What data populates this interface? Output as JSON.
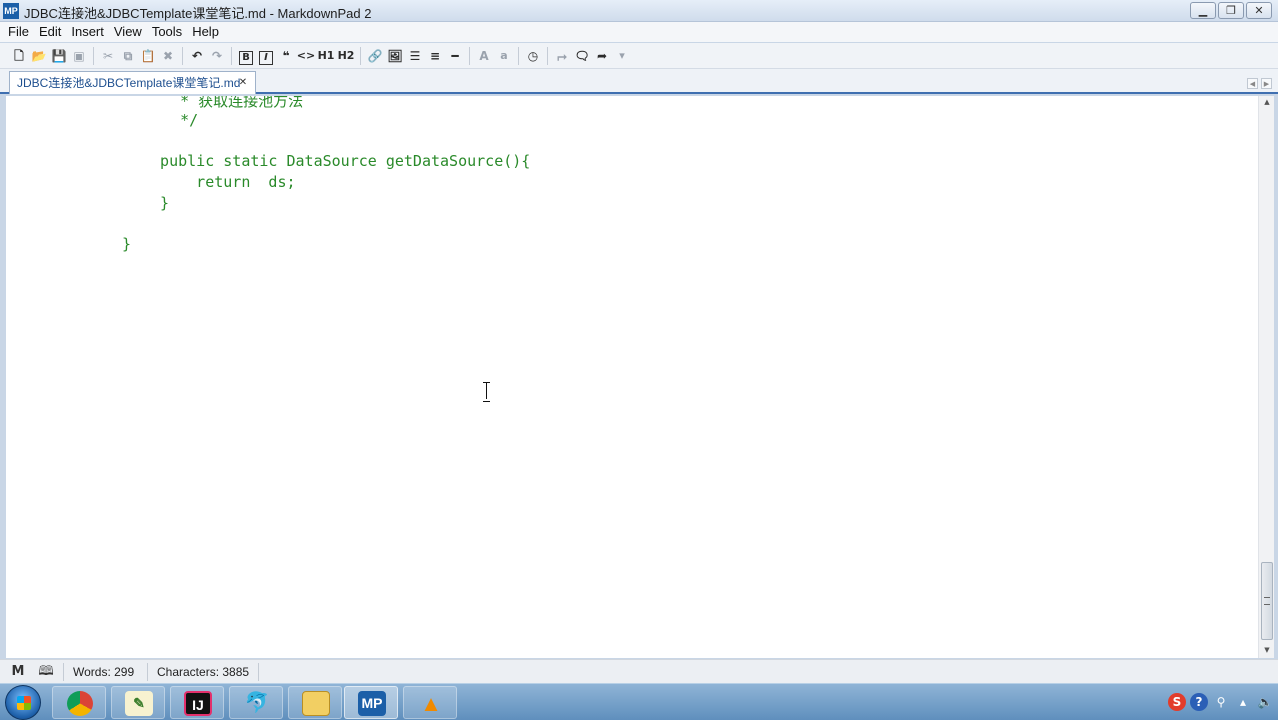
{
  "window": {
    "app_icon_text": "MP",
    "title": "JDBC连接池&JDBCTemplate课堂笔记.md - MarkdownPad 2",
    "minimize": "▁",
    "maximize": "❐",
    "close": "✕"
  },
  "menu": [
    "File",
    "Edit",
    "Insert",
    "View",
    "Tools",
    "Help"
  ],
  "toolbar": {
    "bold": "B",
    "italic": "I",
    "quote": "❝",
    "code": "<>",
    "h1": "H1",
    "h2": "H2",
    "font_large": "A",
    "font_small": "a"
  },
  "tab": {
    "label": "JDBC连接池&JDBCTemplate课堂笔记.md",
    "close": "✕"
  },
  "editor": {
    "lines": [
      "   * 获取连接池方法",
      "   */",
      "",
      "  public static DataSource getDataSource(){",
      "      return  ds;",
      "  }",
      "",
      "}"
    ]
  },
  "status": {
    "words": "Words: 299",
    "characters": "Characters: 3885"
  },
  "taskbar": {
    "mp_label": "MP",
    "ij_label": "IJ"
  },
  "colors": {
    "code_text": "#2a8a2a",
    "tab_underline": "#3f6fb0"
  }
}
